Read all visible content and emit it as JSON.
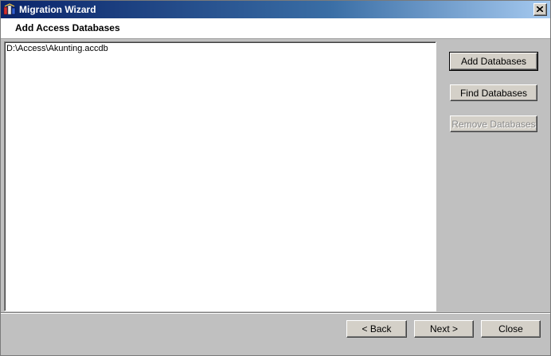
{
  "window": {
    "title": "Migration Wizard",
    "icon": "migration-wizard-icon"
  },
  "header": {
    "title": "Add Access Databases"
  },
  "databases": [
    "D:\\Access\\Akunting.accdb"
  ],
  "side_buttons": {
    "add": "Add Databases",
    "find": "Find Databases",
    "remove": "Remove Databases"
  },
  "nav_buttons": {
    "back": "< Back",
    "next": "Next >",
    "close": "Close"
  }
}
